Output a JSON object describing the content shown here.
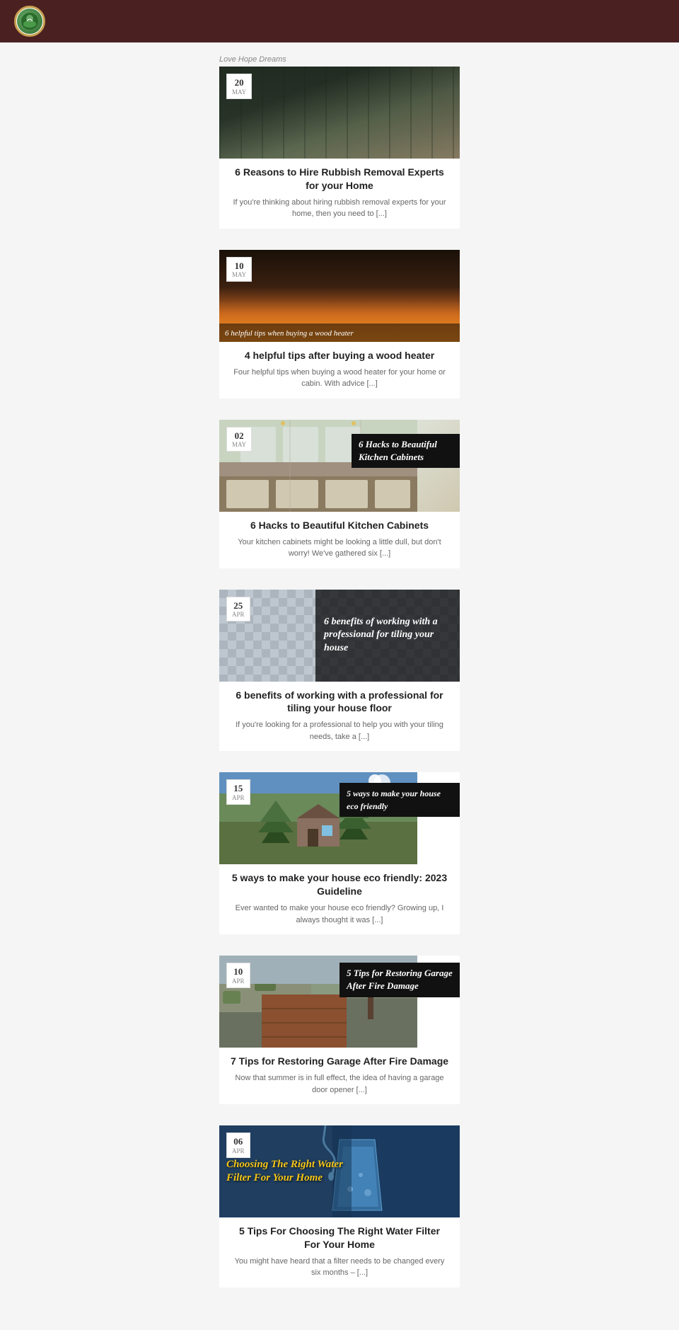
{
  "header": {
    "logo_alt": "EcoHouse Logo"
  },
  "site": {
    "title": "Love Hope Dreams"
  },
  "posts": [
    {
      "id": "rubbish-removal",
      "date_day": "20",
      "date_month": "May",
      "image_type": "rubbish",
      "title": "6 Reasons to Hire Rubbish Removal Experts for your Home",
      "excerpt": "If you're thinking about hiring rubbish removal experts for your home, then you need to [...]",
      "overlay_text": null,
      "overlay_style": null
    },
    {
      "id": "wood-heater",
      "date_day": "10",
      "date_month": "May",
      "image_type": "woodheater",
      "title": "4 helpful tips after buying a wood heater",
      "excerpt": "Four helpful tips when buying a wood heater for your home or cabin. With advice [...]",
      "overlay_text": "6 helpful tips when buying a wood heater",
      "overlay_style": "dark-bottom"
    },
    {
      "id": "kitchen-cabinets",
      "date_day": "02",
      "date_month": "May",
      "image_type": "kitchen",
      "title": "6 Hacks to Beautiful Kitchen Cabinets",
      "excerpt": "Your kitchen cabinets might be looking a little dull, but don't worry! We've gathered six [...]",
      "overlay_text": "6 Hacks to Beautiful Kitchen Cabinets",
      "overlay_style": "dark-corner"
    },
    {
      "id": "tiling",
      "date_day": "25",
      "date_month": "Apr",
      "image_type": "tiling",
      "title": "6 benefits of working with a professional for tiling your house floor",
      "excerpt": "If you're looking for a professional to help you with your tiling needs, take a [...]",
      "overlay_text": "6 benefits of working with a professional for tiling your house",
      "overlay_style": "dark-right"
    },
    {
      "id": "eco-friendly",
      "date_day": "15",
      "date_month": "Apr",
      "image_type": "eco",
      "title": "5 ways to make your house eco friendly: 2023 Guideline",
      "excerpt": "Ever wanted to make your house eco friendly? Growing up, I always thought it was [...]",
      "overlay_text": "5 ways to make your house eco friendly",
      "overlay_style": "dark-corner"
    },
    {
      "id": "garage-fire",
      "date_day": "10",
      "date_month": "Apr",
      "image_type": "garage",
      "title": "7 Tips for Restoring Garage After Fire Damage",
      "excerpt": "Now that summer is in full effect, the idea of having a garage door opener [...]",
      "overlay_text": "5 Tips for Restoring Garage After Fire Damage",
      "overlay_style": "dark-corner"
    },
    {
      "id": "water-filter",
      "date_day": "06",
      "date_month": "Apr",
      "image_type": "water",
      "title": "5 Tips For Choosing The Right Water Filter For Your Home",
      "excerpt": "You might have heard that a filter needs to be changed every six months – [...]",
      "overlay_text": "Choosing The Right Water Filter For Your Home",
      "overlay_style": "yellow-left"
    }
  ]
}
